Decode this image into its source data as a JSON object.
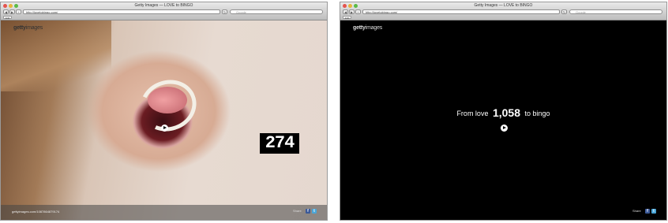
{
  "left_window": {
    "title": "Getty Images — LOVE to BINGO",
    "url": "http://lovetobingo.com/",
    "search_placeholder": "Google",
    "bookmark": "Edit",
    "logo_main": "getty",
    "logo_sub": "images",
    "counter": "274",
    "footer_url": "gettyimages.com/1087864879174",
    "share_label": "Share"
  },
  "right_window": {
    "title": "Getty Images — LOVE to BINGO",
    "url": "http://lovetobingo.com/",
    "search_placeholder": "Google",
    "bookmark": "Edit",
    "logo_main": "getty",
    "logo_sub": "images",
    "headline_pre": "From love",
    "headline_number": "1,058",
    "headline_post": "to bingo",
    "share_label": "Share"
  },
  "icons": {
    "back": "◀",
    "forward": "▶",
    "reload": "↻",
    "add": "+",
    "facebook": "f",
    "twitter": "t"
  },
  "colors": {
    "facebook": "#3b5998",
    "twitter": "#4aa6d8",
    "page_black": "#000000"
  }
}
